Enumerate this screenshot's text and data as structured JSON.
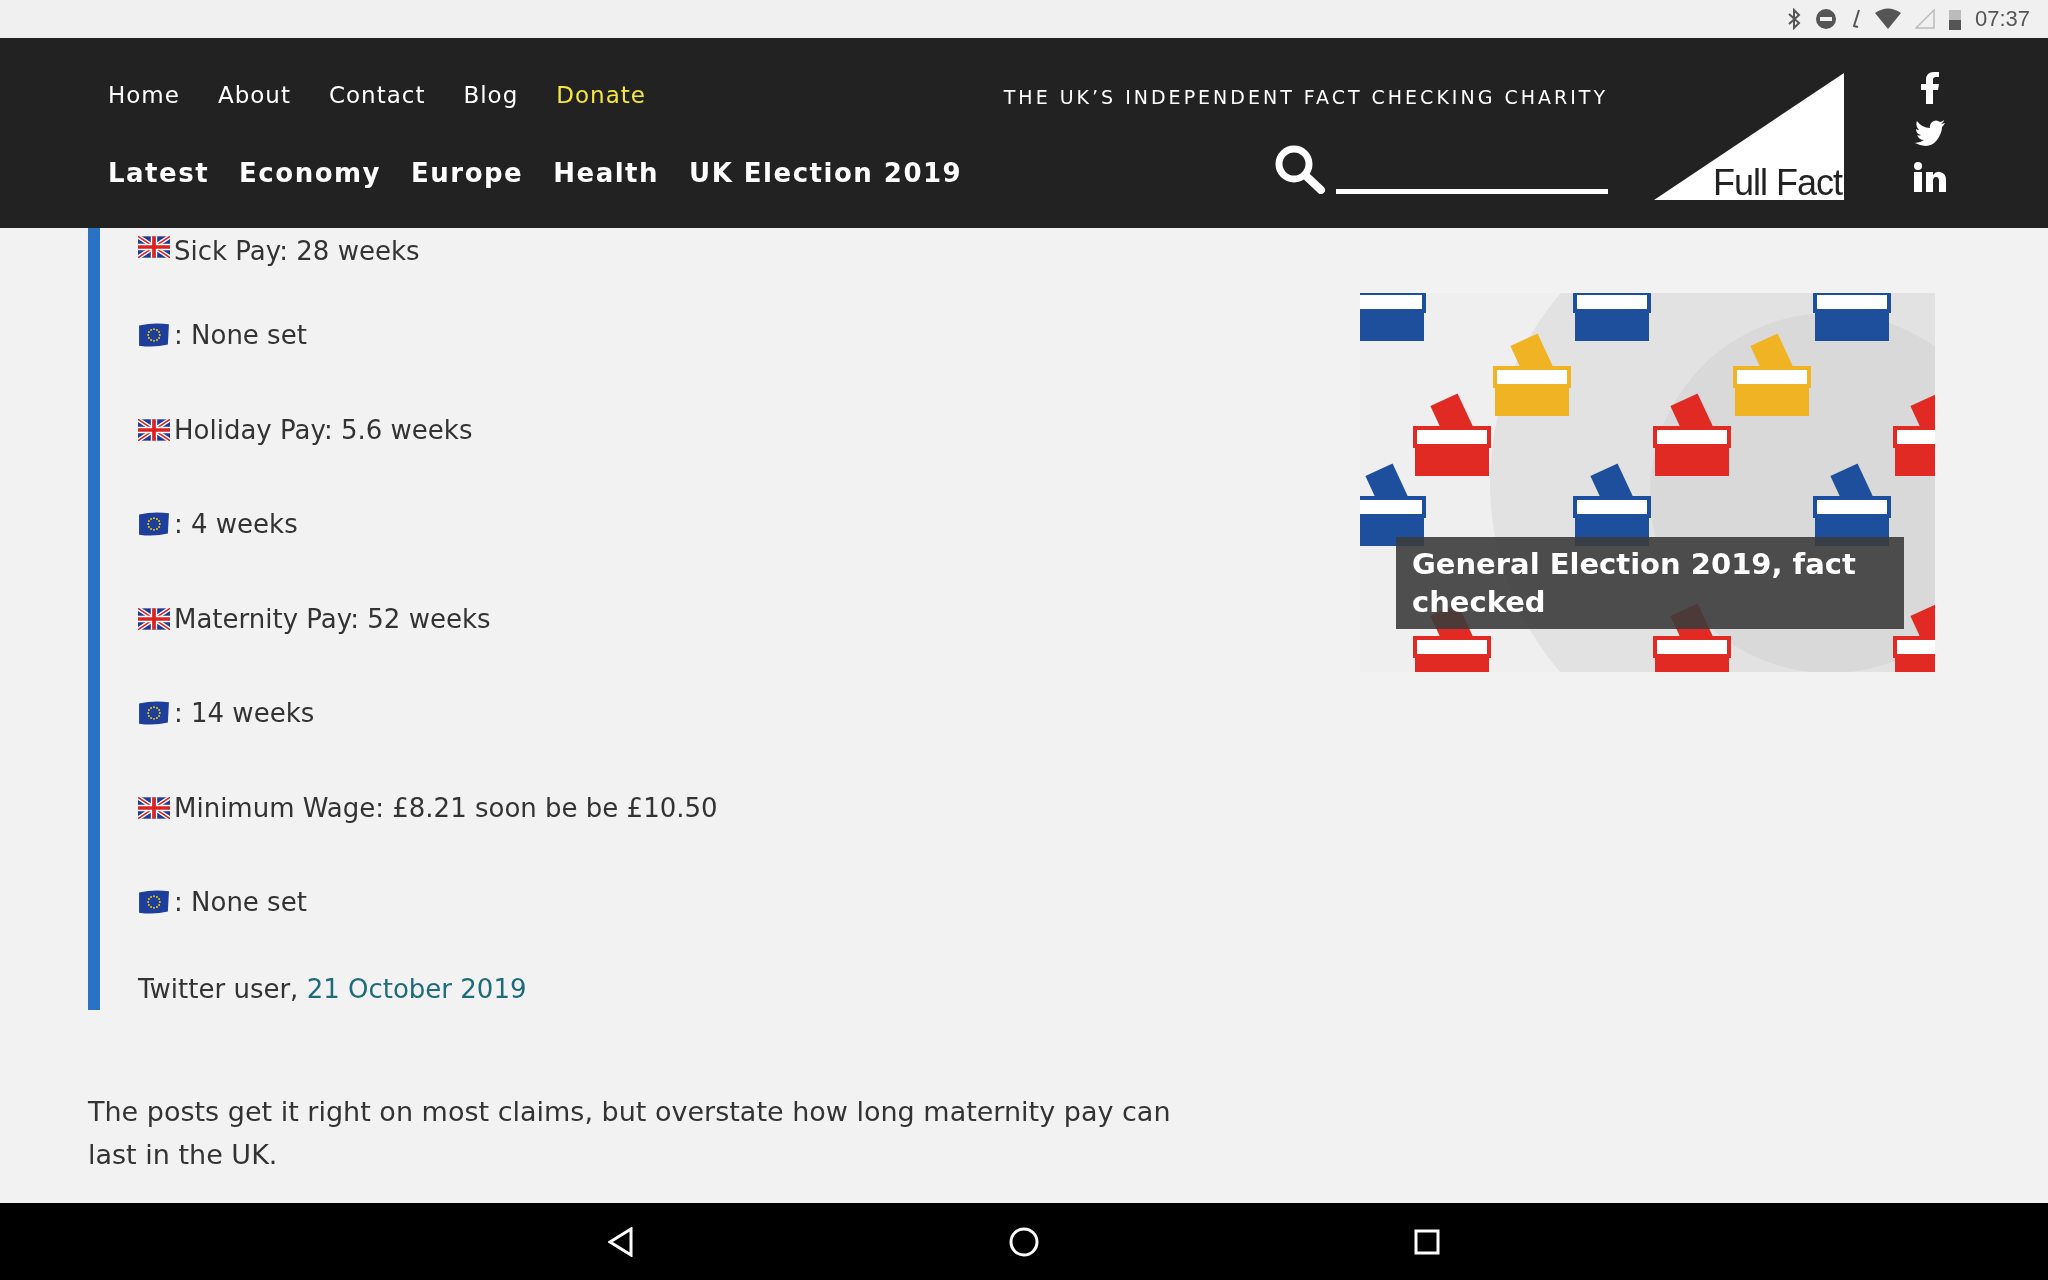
{
  "status_bar": {
    "time": "07:37"
  },
  "header": {
    "top_nav": [
      {
        "label": "Home",
        "highlighted": false
      },
      {
        "label": "About",
        "highlighted": false
      },
      {
        "label": "Contact",
        "highlighted": false
      },
      {
        "label": "Blog",
        "highlighted": false
      },
      {
        "label": "Donate",
        "highlighted": true
      }
    ],
    "tagline": "THE UK’S INDEPENDENT FACT CHECKING CHARITY",
    "main_nav": [
      "Latest",
      "Economy",
      "Europe",
      "Health",
      "UK Election 2019"
    ],
    "logo_text": "Full Fact"
  },
  "quote": {
    "items": [
      {
        "kind": "uk",
        "text": "Sick Pay: 28 weeks"
      },
      {
        "kind": "eu",
        "text": ": None set"
      },
      {
        "kind": "uk",
        "text": "Holiday Pay: 5.6 weeks"
      },
      {
        "kind": "eu",
        "text": ": 4 weeks"
      },
      {
        "kind": "uk",
        "text": "Maternity Pay: 52 weeks"
      },
      {
        "kind": "eu",
        "text": ": 14 weeks"
      },
      {
        "kind": "uk",
        "text": "Minimum Wage: £8.21 soon be be £10.50"
      },
      {
        "kind": "eu",
        "text": ": None set"
      }
    ],
    "attribution": "Twitter user, ",
    "attribution_link": "21 October 2019"
  },
  "paragraph": "The posts get it right on most claims, but overstate how long maternity pay can last in the UK.",
  "feature": {
    "kind": "picture",
    "caption": "General Election 2019, fact checked"
  }
}
